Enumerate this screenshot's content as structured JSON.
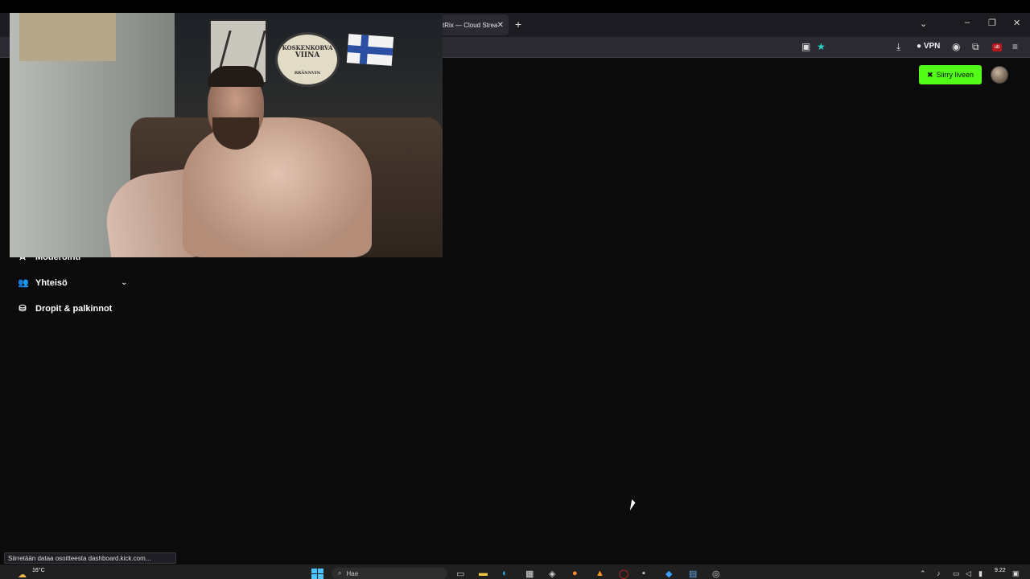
{
  "browser": {
    "tab_title": "tRix — Cloud Strea",
    "tab_close": "✕",
    "new_tab": "+",
    "tabs_list": "⌄",
    "window": {
      "minimize": "–",
      "restore": "❐",
      "close": "✕"
    },
    "vpn_label": "VPN",
    "ublock_label": "ub"
  },
  "page": {
    "go_live_label": "Siirry liveen",
    "sidebar": [
      {
        "label": "Moderointi",
        "icon": "sword-icon"
      },
      {
        "label": "Yhteisö",
        "icon": "community-icon"
      },
      {
        "label": "Dropit & palkinnot",
        "icon": "drops-icon"
      }
    ]
  },
  "webcam": {
    "sign_line1": "KOSKENKORVA",
    "sign_line2": "VIINA",
    "sign_line3": "BRÄNNVIN"
  },
  "status_text": "Siirretään dataa osoitteesta dashboard.kick.com...",
  "taskbar": {
    "weather_temp": "16°C",
    "search_placeholder": "Hae",
    "time": "9.22"
  },
  "colors": {
    "kick_green": "#53fc18",
    "bookmark_star": "#2ad4c9"
  }
}
